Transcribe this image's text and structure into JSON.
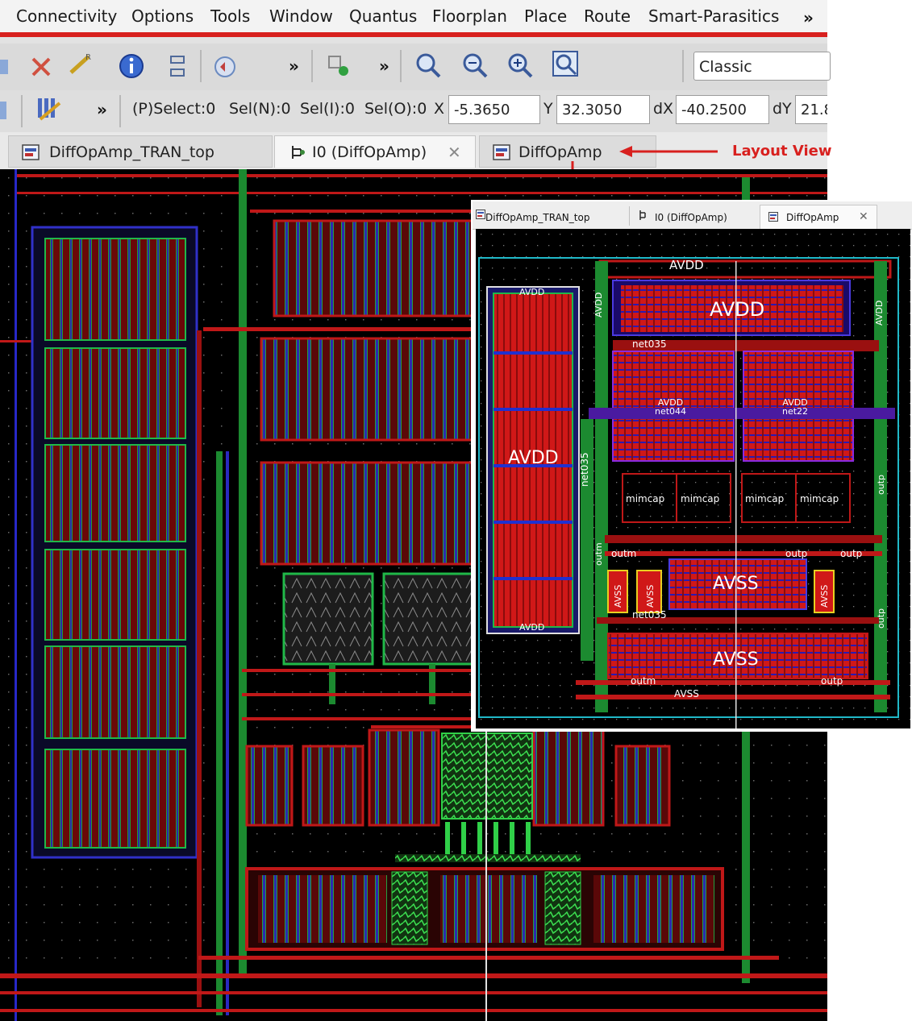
{
  "menubar": {
    "items": [
      "Connectivity",
      "Options",
      "Tools",
      "Window",
      "Quantus",
      "Floorplan",
      "Place",
      "Route",
      "Smart-Parasitics"
    ],
    "more_label": "»"
  },
  "toolbar1": {
    "overflow_1": "»",
    "overflow_2": "»",
    "workspace_value": "Classic",
    "icons": [
      "select-icon",
      "delete-icon",
      "wire-icon",
      "info-icon",
      "hierarchy-icon",
      "undo-icon",
      "instance-icon",
      "zoom-icon",
      "zoom-in-icon",
      "zoom-out-icon",
      "zoom-fit-icon"
    ]
  },
  "toolbar2": {
    "overflow": "»",
    "status": {
      "p_select": "(P)Select:0",
      "sel_n": "Sel(N):0",
      "sel_i": "Sel(I):0",
      "sel_o": "Sel(O):0"
    },
    "coords": {
      "x_label": "X",
      "x_value": "-5.3650",
      "y_label": "Y",
      "y_value": "32.3050",
      "dx_label": "dX",
      "dx_value": "-40.2500",
      "dy_label": "dY",
      "dy_value": "21.8"
    }
  },
  "tabs": [
    {
      "label": "DiffOpAmp_TRAN_top",
      "active": false
    },
    {
      "label": "I0 (DiffOpAmp)",
      "active": true,
      "close": "✕"
    },
    {
      "label": "DiffOpAmp",
      "active": false
    }
  ],
  "annotation": {
    "label": "Layout View",
    "color": "#d8201e"
  },
  "inset": {
    "tabs": [
      {
        "label": "DiffOpAmp_TRAN_top"
      },
      {
        "label": "I0 (DiffOpAmp)"
      },
      {
        "label": "DiffOpAmp",
        "active": true,
        "close": "✕"
      }
    ],
    "labels": {
      "avdd_top": "AVDD",
      "avdd_big_right": "AVDD",
      "avdd_left_col_top": "AVDD",
      "avdd_left_col_bottom": "AVDD",
      "avdd_left_big": "AVDD",
      "avdd_vert_left": "AVDD",
      "avdd_vert_right": "AVDD",
      "net035_top": "net035",
      "net044": "AVDD\nnet044",
      "net022": "AVDD\nnet22",
      "net035_vert": "net035",
      "mimcap1": "mimcap",
      "mimcap2": "mimcap",
      "mimcap3": "mimcap",
      "mimcap4": "mimcap",
      "outm_1": "outm",
      "outm_2": "outm",
      "outm_vert": "outm",
      "outp_1": "outp",
      "outp_2": "outp",
      "outp_3": "outp",
      "outp_vert_1": "outp",
      "outp_vert_2": "outp",
      "avss_mid": "AVSS",
      "avss_bottom": "AVSS",
      "avss_small_1": "AVSS",
      "avss_small_2": "AVSS",
      "avss_small_3": "AVSS",
      "avss_bus": "AVSS",
      "net035_low": "net035"
    }
  },
  "colors": {
    "menu_underline": "#d8201e",
    "canvas_bg": "#000000",
    "metal_red": "#d01818",
    "poly_green": "#2fb84a",
    "diff_blue": "#2a2ad0",
    "outline_cyan": "#20b8c8"
  }
}
